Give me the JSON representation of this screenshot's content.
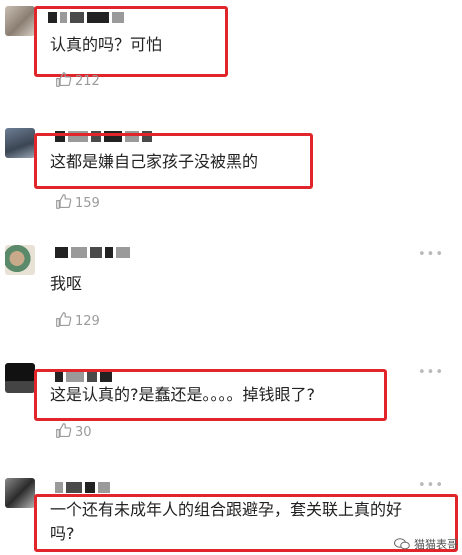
{
  "comments": [
    {
      "text": "认真的吗？可怕",
      "likes": "212",
      "more": ""
    },
    {
      "text": "这都是嫌自己家孩子没被黑的",
      "likes": "159",
      "more": ""
    },
    {
      "text": "我呕",
      "likes": "129",
      "more": "•••"
    },
    {
      "text": "这是认真的?是蠢还是。。。。掉钱眼了?",
      "likes": "30",
      "more": "•••"
    },
    {
      "text_line1": "一个还有未成年人的组合跟避孕，套关联上真的好",
      "text_line2": "吗?",
      "likes": "",
      "more": "•••"
    }
  ],
  "watermark": {
    "text": "猫猫表哥"
  },
  "colors": {
    "highlight": "#e0252b",
    "muted": "#9b9b9b"
  },
  "icons": {
    "like": "thumbs-up-icon",
    "more": "more-dots-icon",
    "watermark": "wechat-icon"
  }
}
